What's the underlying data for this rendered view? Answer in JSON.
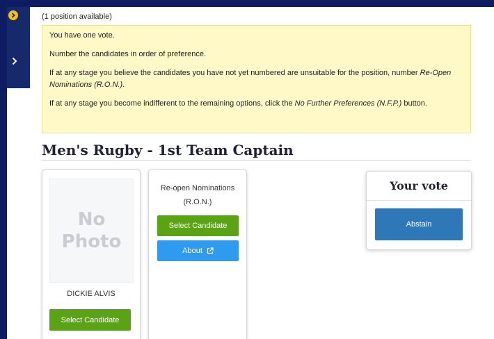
{
  "availability": "(1 position available)",
  "notice": {
    "line1": "You have one vote.",
    "line2": "Number the candidates in order of preference.",
    "line3_pre": "If at any stage you believe the candidates you have not yet numbered are unsuitable for the position, number ",
    "line3_em": "Re-Open Nominations (R.O.N.)",
    "line3_post": ".",
    "line4_pre": "If at any stage you become indifferent to the remaining options, click the ",
    "line4_em": "No Further Preferences (N.F.P.)",
    "line4_post": " button."
  },
  "position_title": "Men's Rugby - 1st Team Captain",
  "candidates": [
    {
      "photo_line1": "No",
      "photo_line2": "Photo",
      "name": "DICKIE ALVIS",
      "select_label": "Select Candidate"
    }
  ],
  "ron": {
    "title_line1": "Re-open Nominations",
    "title_line2": "(R.O.N.)",
    "select_label": "Select Candidate",
    "about_label": "About"
  },
  "vote": {
    "title": "Your vote",
    "abstain_label": "Abstain"
  },
  "colors": {
    "background": "#0e1d63",
    "notice_bg": "#fff9c7",
    "select_green": "#5aa315",
    "about_blue": "#2f9bf0",
    "abstain_blue": "#2f78b8",
    "accent_yellow": "#f4c20d"
  },
  "icons": {
    "side_primary": "chevron-circle-right-icon",
    "side_secondary": "chevron-right-icon",
    "about": "external-link-icon"
  }
}
